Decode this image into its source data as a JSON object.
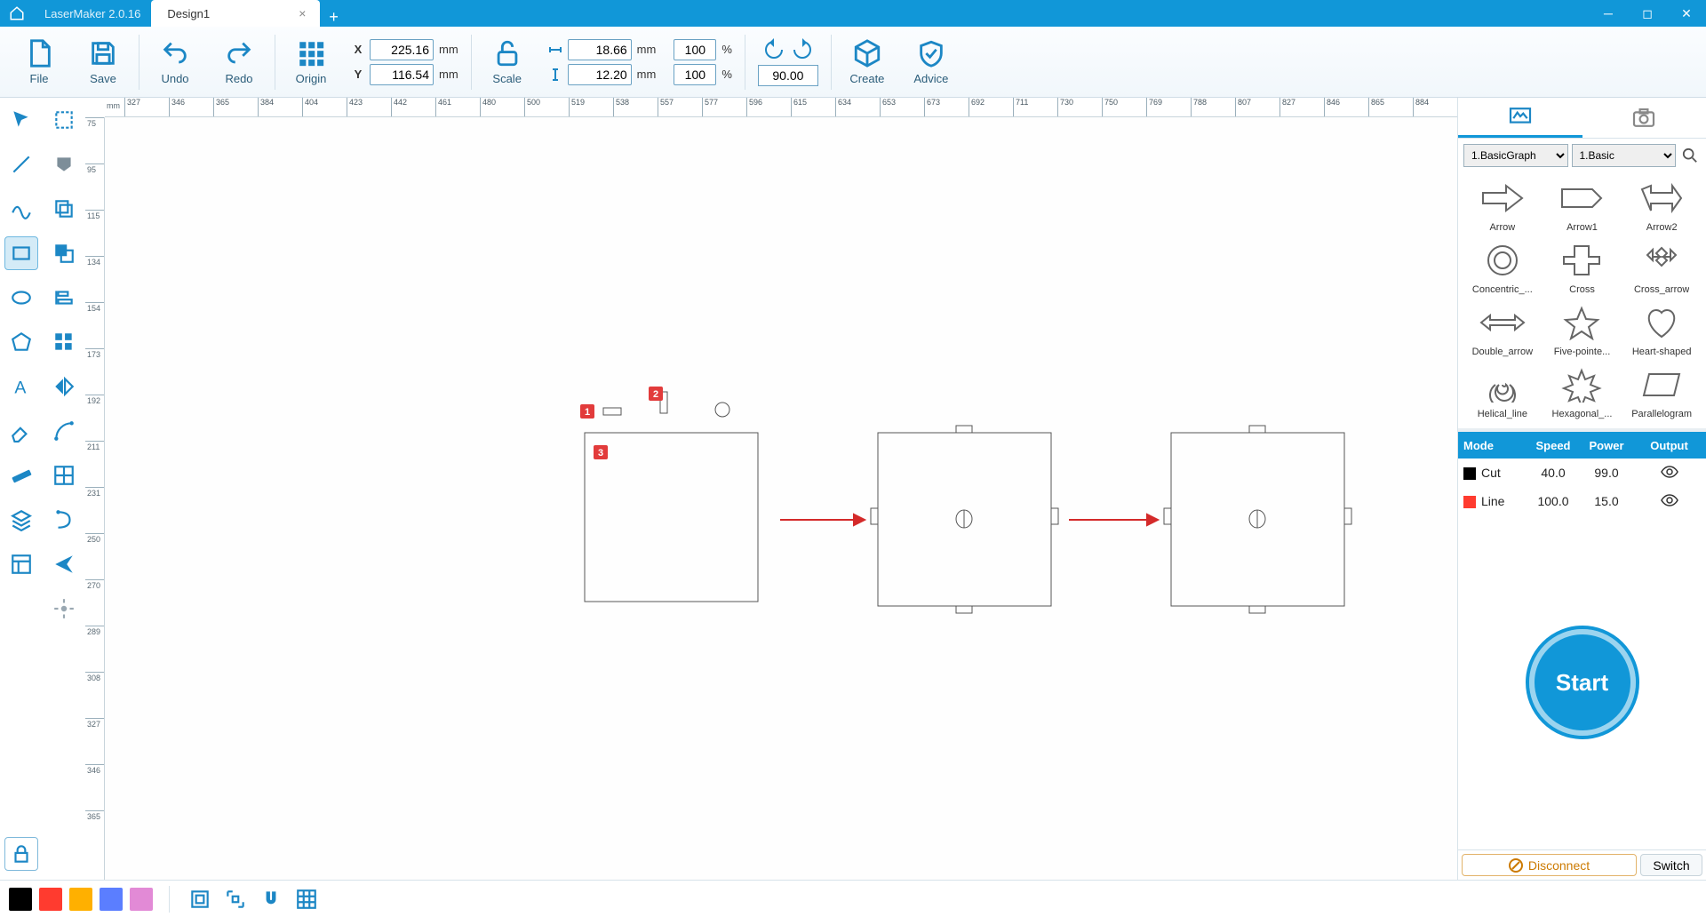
{
  "app": {
    "title": "LaserMaker 2.0.16"
  },
  "tab": {
    "name": "Design1"
  },
  "toolbar": {
    "file": "File",
    "save": "Save",
    "undo": "Undo",
    "redo": "Redo",
    "origin": "Origin",
    "scale": "Scale",
    "create": "Create",
    "advice": "Advice"
  },
  "coords": {
    "x": "225.16",
    "y": "116.54",
    "unit": "mm",
    "w": "18.66",
    "h": "12.20",
    "pctW": "100",
    "pctH": "100",
    "pct": "%",
    "rot": "90.00"
  },
  "hruler_mm": "mm",
  "hruler": [
    "327",
    "346",
    "365",
    "384",
    "404",
    "423",
    "442",
    "461",
    "480",
    "500",
    "519",
    "538",
    "557",
    "577",
    "596",
    "615",
    "634",
    "653",
    "673",
    "692",
    "711",
    "730",
    "750",
    "769",
    "788",
    "807",
    "827",
    "846",
    "865",
    "884"
  ],
  "vruler": [
    "75",
    "95",
    "115",
    "134",
    "154",
    "173",
    "192",
    "211",
    "231",
    "250",
    "270",
    "289",
    "308",
    "327",
    "346",
    "365"
  ],
  "shapes": {
    "filter1": "1.BasicGraph",
    "filter2": "1.Basic",
    "items": [
      "Arrow",
      "Arrow1",
      "Arrow2",
      "Concentric_...",
      "Cross",
      "Cross_arrow",
      "Double_arrow",
      "Five-pointe...",
      "Heart-shaped",
      "Helical_line",
      "Hexagonal_...",
      "Parallelogram"
    ]
  },
  "layers": {
    "headers": {
      "mode": "Mode",
      "speed": "Speed",
      "power": "Power",
      "output": "Output"
    },
    "rows": [
      {
        "color": "#000000",
        "mode": "Cut",
        "speed": "40.0",
        "power": "99.0"
      },
      {
        "color": "#ff3b2f",
        "mode": "Line",
        "speed": "100.0",
        "power": "15.0"
      }
    ]
  },
  "start": "Start",
  "connection": {
    "disconnect": "Disconnect",
    "switch": "Switch"
  },
  "palette": [
    "#000000",
    "#ff3b2f",
    "#ffb000",
    "#5b7eff",
    "#e28ad6"
  ],
  "badges": {
    "1": "1",
    "2": "2",
    "3": "3"
  }
}
